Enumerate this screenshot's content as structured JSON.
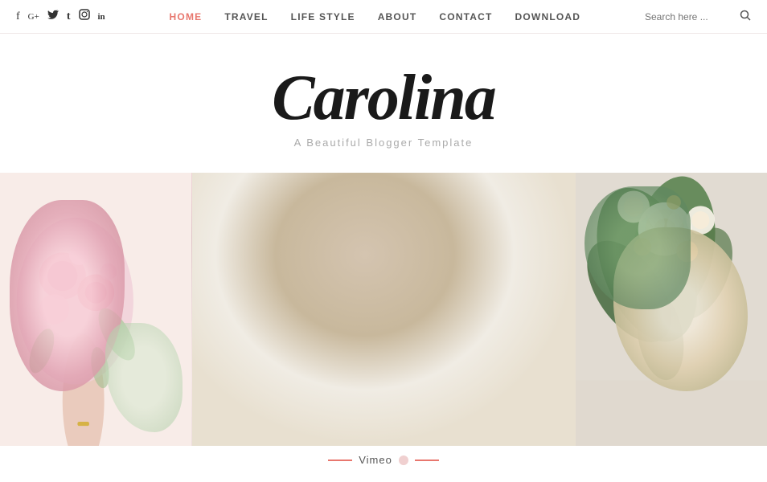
{
  "header": {
    "social_icons": [
      {
        "name": "facebook-icon",
        "symbol": "f",
        "label": "Facebook"
      },
      {
        "name": "google-plus-icon",
        "symbol": "G+",
        "label": "Google Plus"
      },
      {
        "name": "twitter-icon",
        "symbol": "𝕏",
        "label": "Twitter"
      },
      {
        "name": "tumblr-icon",
        "symbol": "t",
        "label": "Tumblr"
      },
      {
        "name": "instagram-icon",
        "symbol": "◻",
        "label": "Instagram"
      },
      {
        "name": "linkedin-icon",
        "symbol": "in",
        "label": "LinkedIn"
      }
    ],
    "nav": {
      "items": [
        {
          "label": "HOME",
          "active": true
        },
        {
          "label": "TRAVEL",
          "active": false
        },
        {
          "label": "LIFE STYLE",
          "active": false
        },
        {
          "label": "ABOUT",
          "active": false
        },
        {
          "label": "CONTACT",
          "active": false
        },
        {
          "label": "DOWNLOAD",
          "active": false
        }
      ]
    },
    "search": {
      "placeholder": "Search here ...",
      "icon": "🔍"
    }
  },
  "brand": {
    "title": "Carolina",
    "subtitle": "A Beautiful Blogger Template"
  },
  "gallery": {
    "images": [
      {
        "id": "flowers",
        "alt": "Pink flowers bouquet"
      },
      {
        "id": "coffee",
        "alt": "Coffee cup with book and glasses"
      },
      {
        "id": "floral",
        "alt": "Floral arrangement"
      }
    ]
  },
  "footer_bar": {
    "label": "Vimeo",
    "line_color": "#e8776e"
  }
}
